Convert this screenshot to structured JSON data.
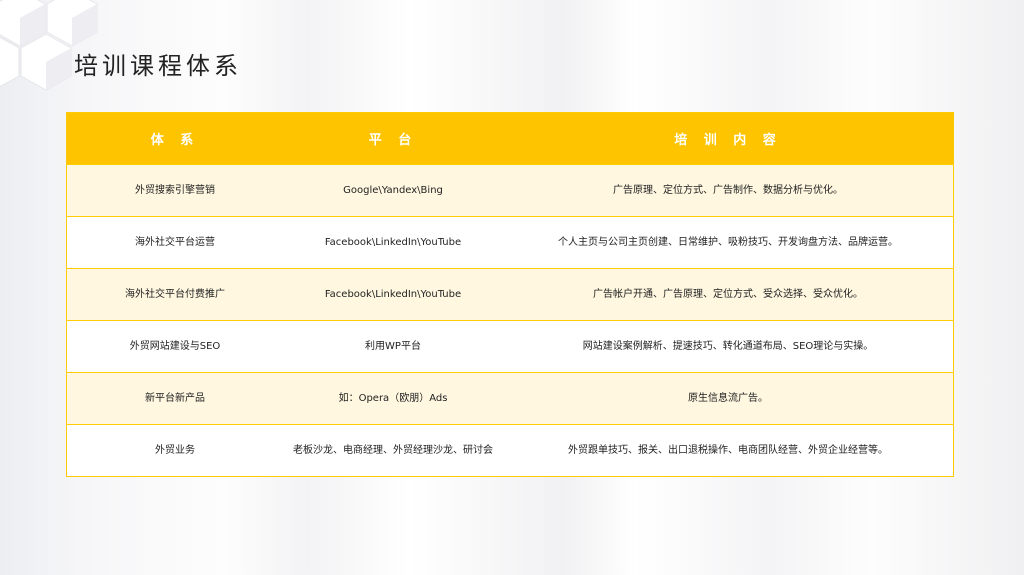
{
  "title": "培训课程体系",
  "header": [
    "体 系",
    "平 台",
    "培 训 内 容"
  ],
  "rows": [
    {
      "system": "外贸搜索引擎营销",
      "platform": "Google\\Yandex\\Bing",
      "content": "广告原理、定位方式、广告制作、数据分析与优化。"
    },
    {
      "system": "海外社交平台运营",
      "platform": "Facebook\\LinkedIn\\YouTube",
      "content": "个人主页与公司主页创建、日常维护、吸粉技巧、开发询盘方法、品牌运营。"
    },
    {
      "system": "海外社交平台付费推广",
      "platform": "Facebook\\LinkedIn\\YouTube",
      "content": "广告帐户开通、广告原理、定位方式、受众选择、受众优化。"
    },
    {
      "system": "外贸网站建设与SEO",
      "platform": "利用WP平台",
      "content": "网站建设案例解析、提速技巧、转化通道布局、SEO理论与实操。"
    },
    {
      "system": "新平台新产品",
      "platform": "如：Opera（欧朋）Ads",
      "content": "原生信息流广告。"
    },
    {
      "system": "外贸业务",
      "platform": "老板沙龙、电商经理、外贸经理沙龙、研讨会",
      "content": "外贸跟单技巧、报关、出口退税操作、电商团队经营、外贸企业经营等。"
    }
  ]
}
